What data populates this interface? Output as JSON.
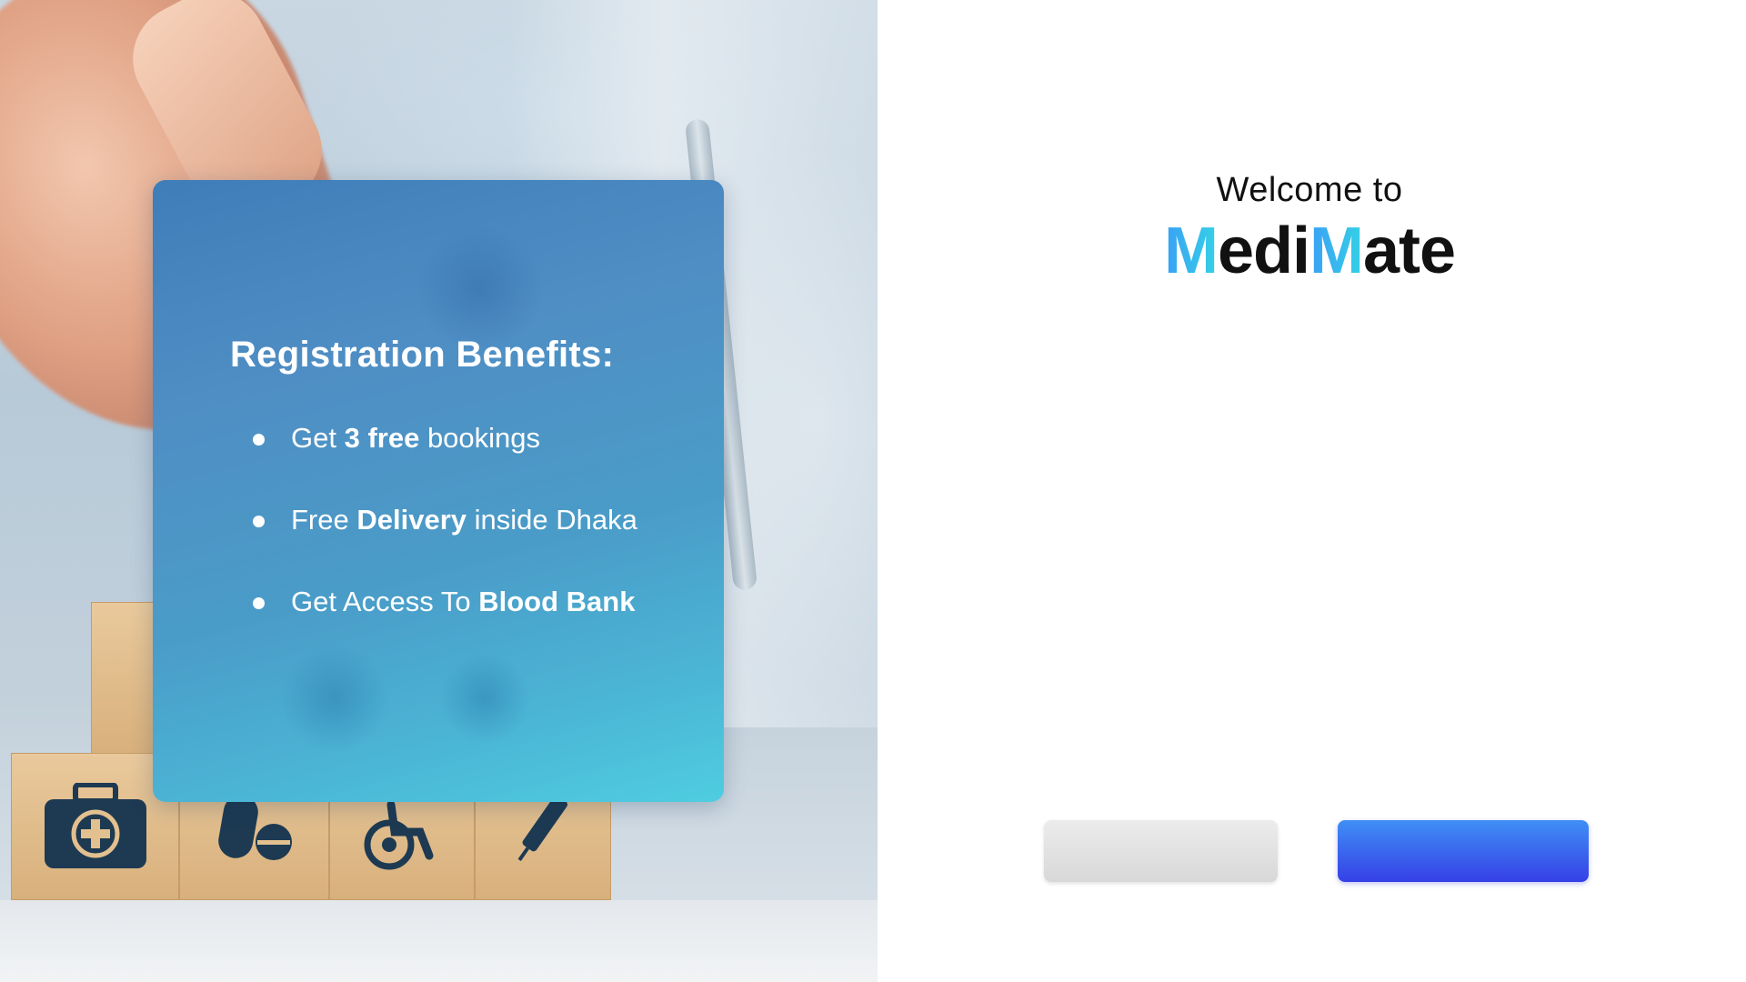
{
  "hero": {
    "image_icons": [
      "first-aid-kit-icon",
      "pills-icon",
      "wheelchair-icon",
      "syringe-icon"
    ]
  },
  "benefits_card": {
    "title": "Registration Benefits:",
    "items": [
      {
        "pre": "Get ",
        "bold": "3 free",
        "post": " bookings"
      },
      {
        "pre": "Free ",
        "bold": "Delivery",
        "post": " inside Dhaka"
      },
      {
        "pre": "Get Access To ",
        "bold": "Blood Bank",
        "post": ""
      }
    ]
  },
  "welcome": {
    "greeting": "Welcome to",
    "brand_parts": [
      "M",
      "edi",
      "M",
      "ate"
    ]
  },
  "actions": {
    "secondary_label": "",
    "primary_label": ""
  },
  "colors": {
    "brand_gradient_start": "#3aa0f5",
    "brand_gradient_end": "#34d1e6",
    "primary_button": "#3640e6",
    "secondary_button": "#e0e0e0",
    "card_top": "#3f7db9",
    "card_bottom": "#4fcde0"
  }
}
